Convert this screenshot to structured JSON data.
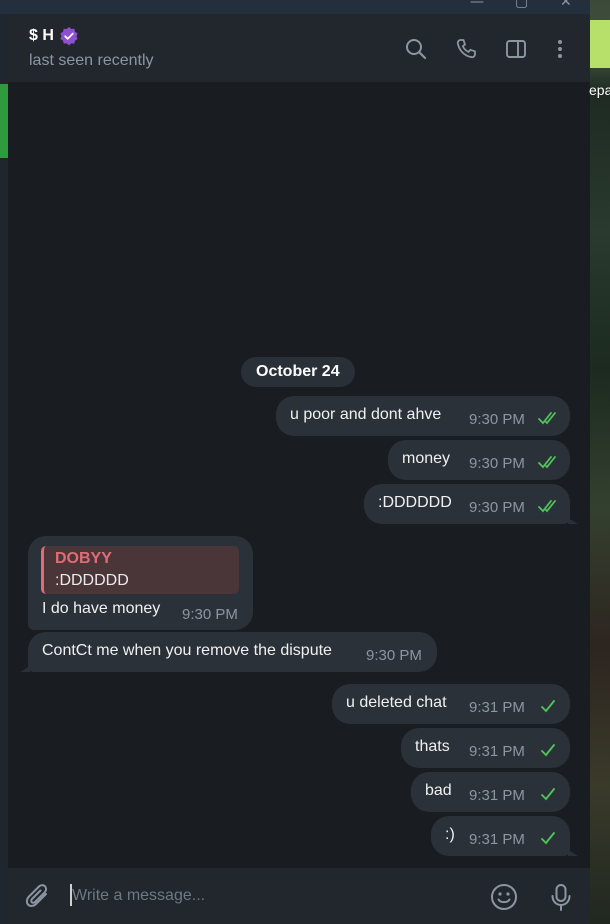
{
  "header": {
    "name": "$ H",
    "status": "last seen recently"
  },
  "date_separator": "October 24",
  "messages_out_1": [
    {
      "text": "u poor and dont ahve",
      "time": "9:30 PM"
    },
    {
      "text": "money",
      "time": "9:30 PM"
    },
    {
      "text": ":DDDDDD",
      "time": "9:30 PM"
    }
  ],
  "reply": {
    "quote_author": "DOBYY",
    "quote_text": ":DDDDDD",
    "text": "I do have money",
    "time": "9:30 PM"
  },
  "incoming_2": {
    "text": "ContCt me when you remove the dispute",
    "time": "9:30 PM"
  },
  "messages_out_2": [
    {
      "text": "u deleted chat",
      "time": "9:31 PM"
    },
    {
      "text": "thats",
      "time": "9:31 PM"
    },
    {
      "text": "bad",
      "time": "9:31 PM"
    },
    {
      "text": ":)",
      "time": "9:31 PM"
    }
  ],
  "composer": {
    "placeholder": "Write a message..."
  },
  "background_peek_text": "epa",
  "colors": {
    "accent_green": "#4fc45a",
    "quote_red": "#e06c75",
    "verified": "#8e4fd1"
  }
}
